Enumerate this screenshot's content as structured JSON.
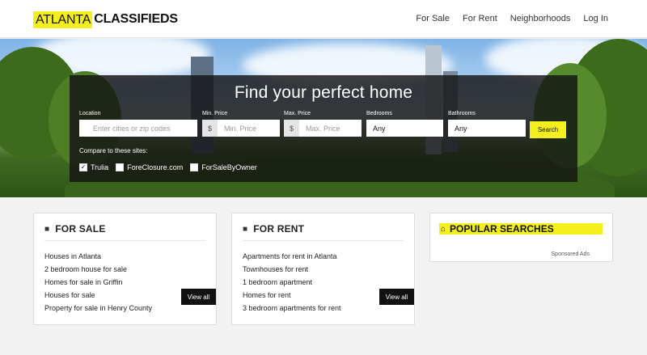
{
  "header": {
    "logo_part1": "ATLANTA",
    "logo_part2": "CLASSIFIEDS",
    "nav": [
      "For Sale",
      "For Rent",
      "Neighborhoods",
      "Log In"
    ]
  },
  "hero": {
    "title": "Find your perfect home",
    "location": {
      "label": "Location",
      "placeholder": "Enter cities or zip codes"
    },
    "min_price": {
      "label": "Min. Price",
      "prefix": "$",
      "placeholder": "Min. Price"
    },
    "max_price": {
      "label": "Max. Price",
      "prefix": "$",
      "placeholder": "Max. Price"
    },
    "bedrooms": {
      "label": "Bedrooms",
      "value": "Any"
    },
    "bathrooms": {
      "label": "Bathrooms",
      "value": "Any"
    },
    "search_label": "Search",
    "compare_label": "Compare to these sites:",
    "compare_sites": [
      {
        "label": "Trulia",
        "checked": true
      },
      {
        "label": "ForeClosure.com",
        "checked": false
      },
      {
        "label": "ForSaleByOwner",
        "checked": false
      }
    ]
  },
  "for_sale": {
    "title": "FOR SALE",
    "items": [
      "Houses in Atlanta",
      "2 bedroom house for sale",
      "Homes for sale in Griffin",
      "Houses for sale",
      "Property for sale in Henry County"
    ],
    "view_all": "View all"
  },
  "for_rent": {
    "title": "FOR RENT",
    "items": [
      "Apartments for rent in Atlanta",
      "Townhouses for rent",
      "1 bedroom apartment",
      "Homes for rent",
      "3 bedroom apartments for rent"
    ],
    "view_all": "View all"
  },
  "popular": {
    "title": "POPULAR SEARCHES",
    "sponsored": "Sponsored Ads"
  },
  "colors": {
    "accent": "#f5ef1e",
    "dark": "#111111"
  }
}
